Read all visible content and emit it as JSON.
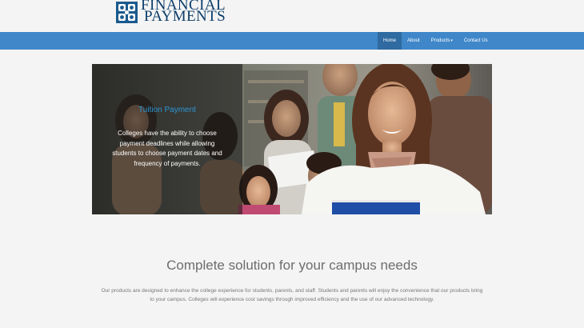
{
  "logo": {
    "line1": "FINANCIAL",
    "line2": "PAYMENTS",
    "color": "#0c3d69"
  },
  "nav": {
    "items": [
      {
        "label": "Home",
        "active": true
      },
      {
        "label": "About"
      },
      {
        "label": "Products",
        "has_dropdown": true
      },
      {
        "label": "Contact Us"
      }
    ],
    "bar_color": "#3f87c9"
  },
  "hero": {
    "title": "Tuition Payment",
    "text": "Colleges have the ability to choose payment deadlines  while allowing students to choose payment dates and frequency of payments."
  },
  "section": {
    "title": "Complete solution for your campus needs",
    "body": "Our products are designed to enhance the college experience for students, parents, and staff. Students and parents will enjoy the convenience that our products bring to your campus. Colleges will experience cost savings through improved efficiency and the use of our advanced technology."
  }
}
